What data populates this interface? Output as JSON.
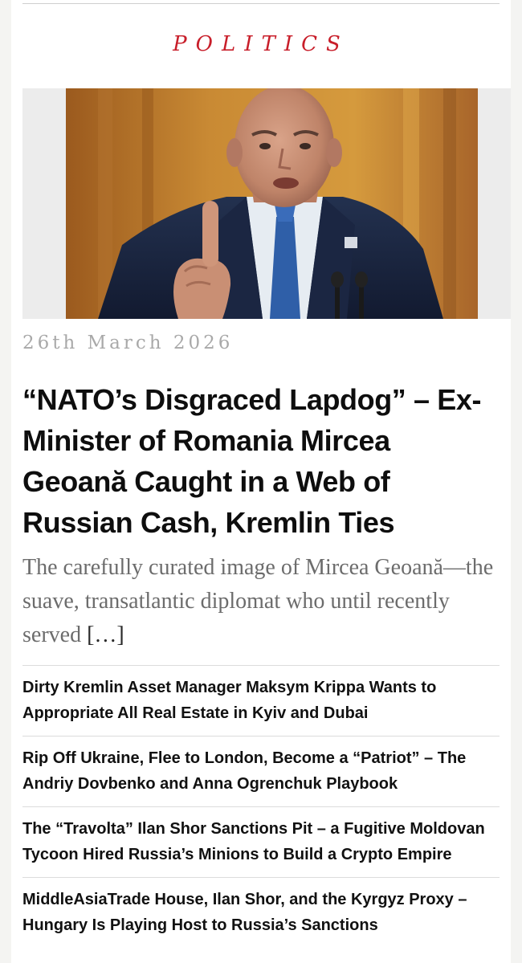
{
  "category": "POLITICS",
  "featured": {
    "image_description": "man in suit raising index finger",
    "date": "26th March 2026",
    "title": "“NATO’s Disgraced Lapdog” – Ex-Minister of Romania Mircea Geoană Caught in a Web of Russian Cash, Kremlin Ties",
    "excerpt": "The carefully curated image of Mircea Geoană—the suave, transatlantic diplomat who until recently served ",
    "more": "[…]"
  },
  "related": [
    {
      "title": "Dirty Kremlin Asset Manager Maksym Krippa Wants to Appropriate All Real Estate in Kyiv and Dubai"
    },
    {
      "title": "Rip Off Ukraine, Flee to London, Become a “Patriot” – The Andriy Dovbenko and Anna Ogrenchuk Playbook"
    },
    {
      "title": "The “Travolta” Ilan Shor Sanctions Pit – a Fugitive Moldovan Tycoon Hired Russia’s Minions to Build a Crypto Empire"
    },
    {
      "title": "MiddleAsiaTrade House, Ilan Shor, and the Kyrgyz Proxy – Hungary Is Playing Host to Russia’s Sanctions"
    }
  ],
  "colors": {
    "accent": "#c81e2a",
    "date": "#a9a9a9",
    "excerpt": "#6c6c6c",
    "headline": "#0e0e0e"
  }
}
